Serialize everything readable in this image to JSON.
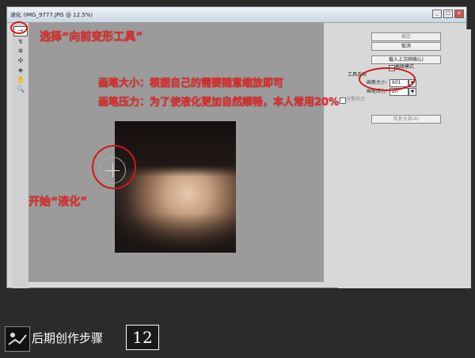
{
  "window": {
    "title": "液化 (IMG_9777.JPG @ 12.5%)",
    "controls": [
      "_",
      "□",
      "x"
    ]
  },
  "tools": [
    {
      "icon": "forward-warp-icon",
      "glyph": "⇢"
    },
    {
      "icon": "reconstruct-icon",
      "glyph": "↯"
    },
    {
      "icon": "twirl-icon",
      "glyph": "✲"
    },
    {
      "icon": "pucker-icon",
      "glyph": "✣"
    },
    {
      "icon": "bloat-icon",
      "glyph": "◈"
    },
    {
      "icon": "hand-icon",
      "glyph": "✋"
    },
    {
      "icon": "zoom-icon",
      "glyph": "🔍"
    }
  ],
  "panel": {
    "ok": "确定",
    "cancel": "取消",
    "load_mesh": "载入上次网格(L)",
    "advanced_mode": "高级模式",
    "tool_options": "工具选项",
    "brush_size_label": "画笔大小:",
    "brush_size_value": "601",
    "brush_pressure_label": "画笔压力:",
    "brush_pressure_value": "20",
    "stylus_pressure": "光笔压力",
    "reconstruct_all": "恢复全部(A)"
  },
  "annotations": {
    "select_tool": "选择“向前变形工具”",
    "brush_size_note": "画笔大小：根据自己的需要随意缩放即可",
    "brush_pressure_note": "画笔压力：为了使液化更加自然顺畅，本人常用20%",
    "start_liquify": "开始“液化”"
  },
  "footer": {
    "step_label": "后期创作步骤",
    "step_number": "12"
  },
  "colors": {
    "annotation_red": "#e83030",
    "canvas_gray": "#9b9b9b",
    "panel_bg": "#d8d8d8",
    "background": "#2b2b2b"
  }
}
